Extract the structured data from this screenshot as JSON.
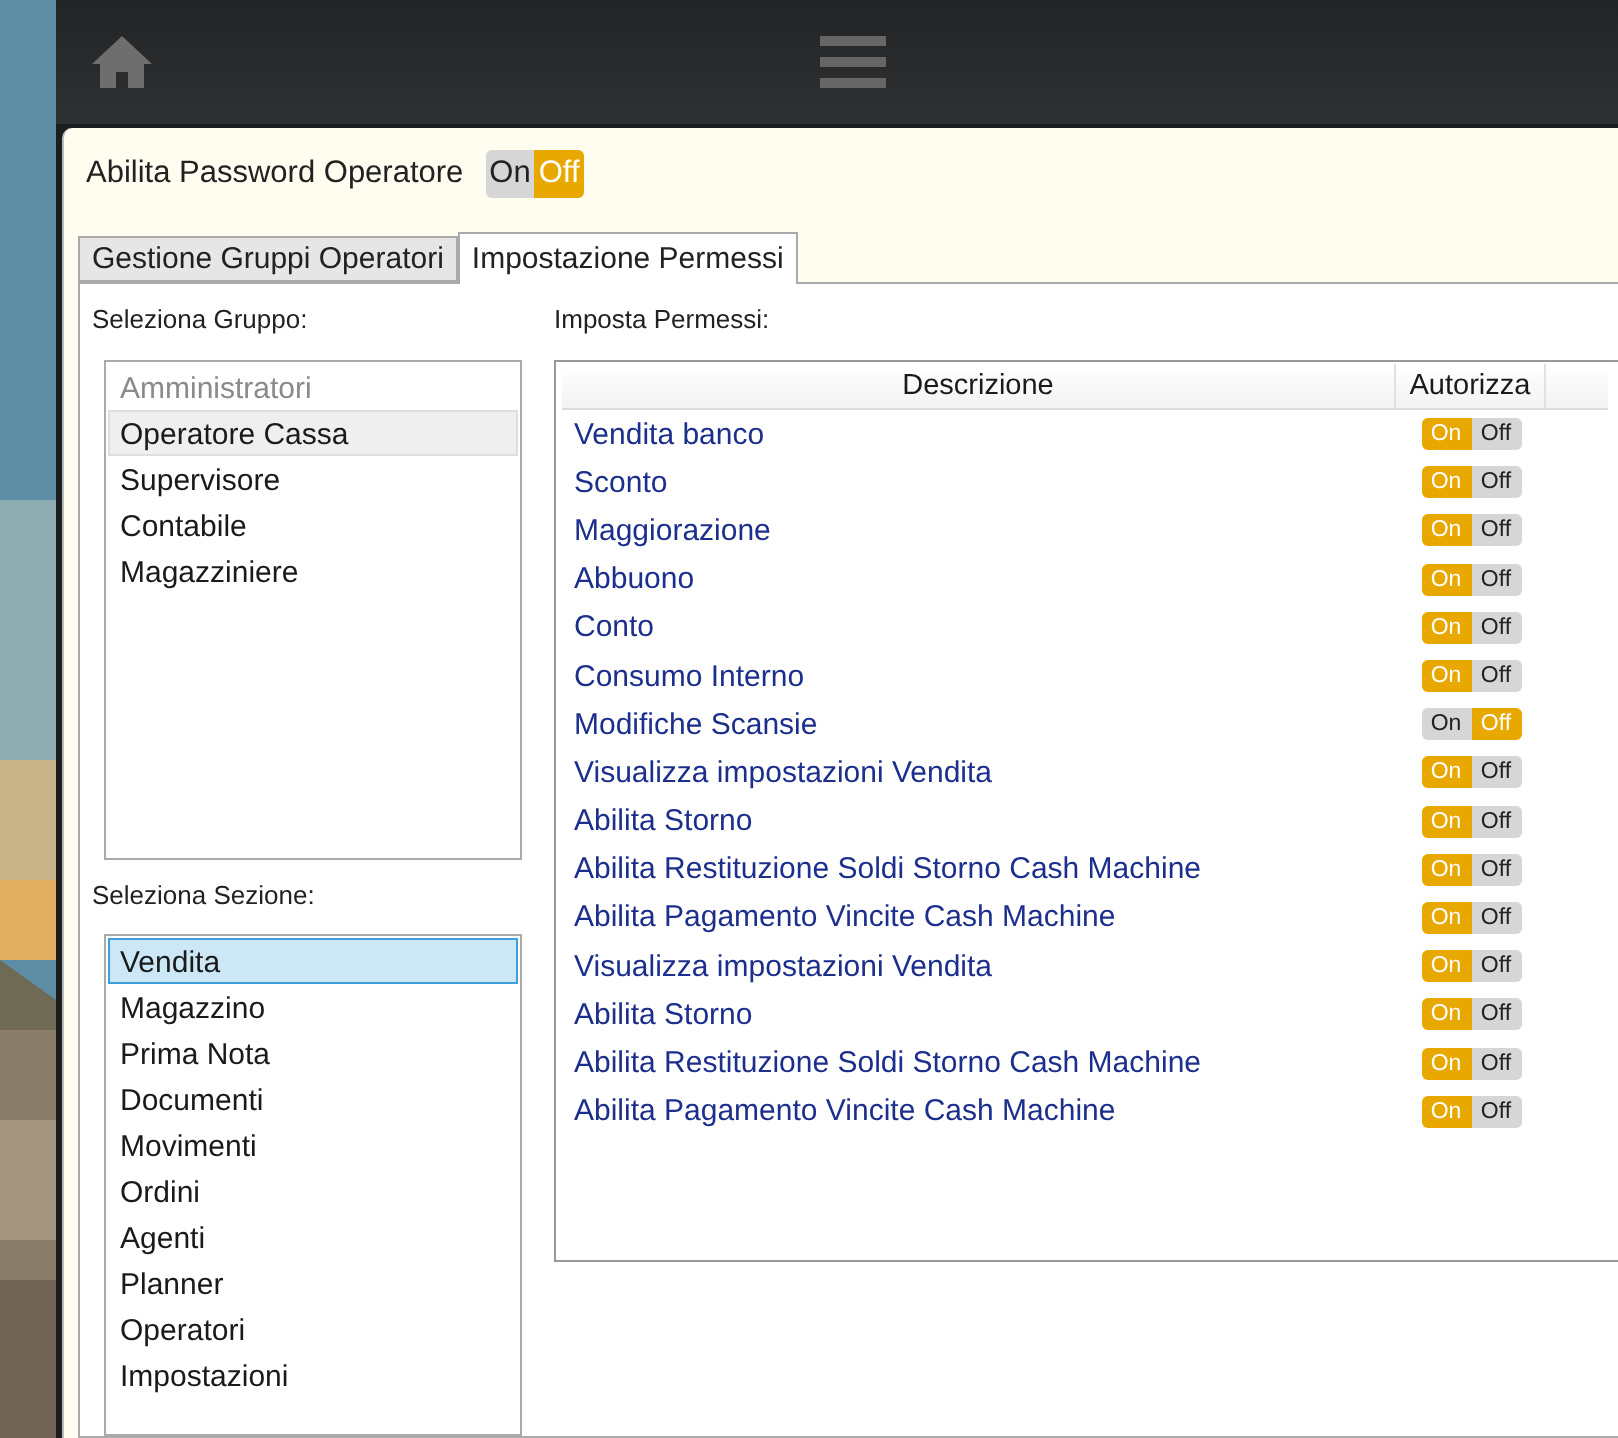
{
  "password_operator": {
    "label": "Abilita Password Operatore",
    "on_label": "On",
    "off_label": "Off",
    "on": false
  },
  "tabs": [
    {
      "label": "Gestione Gruppi Operatori",
      "selected": false
    },
    {
      "label": "Impostazione Permessi",
      "selected": true
    }
  ],
  "groups": {
    "label": "Seleziona Gruppo:",
    "items": [
      {
        "label": "Amministratori",
        "disabled": true,
        "selected": false
      },
      {
        "label": "Operatore Cassa",
        "disabled": false,
        "selected": true
      },
      {
        "label": "Supervisore",
        "disabled": false,
        "selected": false
      },
      {
        "label": "Contabile",
        "disabled": false,
        "selected": false
      },
      {
        "label": "Magazziniere",
        "disabled": false,
        "selected": false
      }
    ]
  },
  "sections": {
    "label": "Seleziona Sezione:",
    "items": [
      {
        "label": "Vendita",
        "selected": true
      },
      {
        "label": "Magazzino",
        "selected": false
      },
      {
        "label": "Prima Nota",
        "selected": false
      },
      {
        "label": "Documenti",
        "selected": false
      },
      {
        "label": "Movimenti",
        "selected": false
      },
      {
        "label": "Ordini",
        "selected": false
      },
      {
        "label": "Agenti",
        "selected": false
      },
      {
        "label": "Planner",
        "selected": false
      },
      {
        "label": "Operatori",
        "selected": false
      },
      {
        "label": "Impostazioni",
        "selected": false
      }
    ]
  },
  "permissions": {
    "label": "Imposta Permessi:",
    "columns": [
      "Descrizione",
      "Autorizza"
    ],
    "rows": [
      {
        "description": "Vendita banco",
        "on_label": "On",
        "off_label": "Off",
        "on": true
      },
      {
        "description": "Sconto",
        "on_label": "On",
        "off_label": "Off",
        "on": true
      },
      {
        "description": "Maggiorazione",
        "on_label": "On",
        "off_label": "Off",
        "on": true
      },
      {
        "description": "Abbuono",
        "on_label": "On",
        "off_label": "Off",
        "on": true
      },
      {
        "description": "Conto",
        "on_label": "On",
        "off_label": "Off",
        "on": true
      },
      {
        "description": "Consumo Interno",
        "on_label": "On",
        "off_label": "Off",
        "on": true
      },
      {
        "description": "Modifiche Scansie",
        "on_label": "On",
        "off_label": "Off",
        "on": false
      },
      {
        "description": "Visualizza impostazioni Vendita",
        "on_label": "On",
        "off_label": "Off",
        "on": true
      },
      {
        "description": "Abilita Storno",
        "on_label": "On",
        "off_label": "Off",
        "on": true
      },
      {
        "description": "Abilita Restituzione Soldi Storno Cash Machine",
        "on_label": "On",
        "off_label": "Off",
        "on": true
      },
      {
        "description": "Abilita Pagamento Vincite Cash Machine",
        "on_label": "On",
        "off_label": "Off",
        "on": true
      },
      {
        "description": "Visualizza impostazioni Vendita",
        "on_label": "On",
        "off_label": "Off",
        "on": true
      },
      {
        "description": "Abilita Storno",
        "on_label": "On",
        "off_label": "Off",
        "on": true
      },
      {
        "description": "Abilita Restituzione Soldi Storno Cash Machine",
        "on_label": "On",
        "off_label": "Off",
        "on": true
      },
      {
        "description": "Abilita Pagamento Vincite Cash Machine",
        "on_label": "On",
        "off_label": "Off",
        "on": true
      }
    ]
  }
}
